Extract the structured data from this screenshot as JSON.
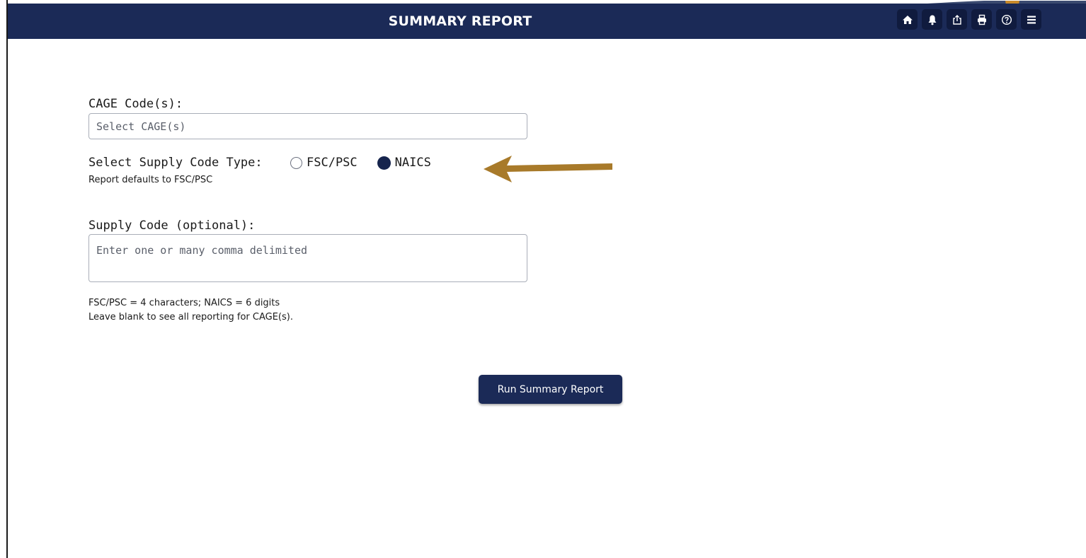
{
  "header": {
    "title": "SUMMARY REPORT",
    "background_color": "#1b2a57",
    "toolbar_icons": [
      "home-icon",
      "bell-icon",
      "share-icon",
      "print-icon",
      "help-icon",
      "menu-icon"
    ]
  },
  "form": {
    "cage": {
      "label": "CAGE Code(s):",
      "placeholder": "Select CAGE(s)",
      "value": ""
    },
    "supply_type": {
      "label": "Select Supply Code Type:",
      "options": [
        {
          "label": "FSC/PSC",
          "selected": false
        },
        {
          "label": "NAICS",
          "selected": true
        }
      ],
      "note": "Report defaults to FSC/PSC"
    },
    "supply_code": {
      "label": "Supply Code (optional):",
      "placeholder": "Enter one or many comma delimited",
      "value": "",
      "hint1": "FSC/PSC = 4 characters; NAICS = 6 digits",
      "hint2": "Leave blank to see all reporting for CAGE(s)."
    },
    "run_button_label": "Run Summary Report"
  },
  "annotation": {
    "arrow_color": "#a87a2a"
  }
}
